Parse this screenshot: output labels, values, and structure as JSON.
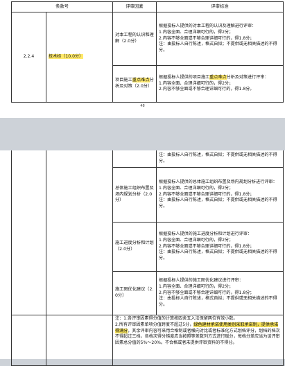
{
  "page1": {
    "headers": [
      "条款号",
      "评审因素",
      "评审标准"
    ],
    "clause_no": "2.2.4",
    "tech_label": "技术标（10.0分）",
    "rows": [
      {
        "factor": "对本工程的认识和理解（2.0分）",
        "lines": [
          "根据投标人提供的对本工程的认识及理解进行评审：",
          "1.内容全面、合理详细可行的，得2分；",
          "2.内容不够全面或不够合理详细可行的，得1.8分；",
          "注：由投标人自行陈述，格式自拟；不提供或无相关描述的不得分。"
        ]
      },
      {
        "factor_pre": "项目施工",
        "factor_hl": "重点难点",
        "factor_post": "分析及对策（2.0分）",
        "std_pre": "根据投标人提供的项目施工",
        "std_hl": "重点难点",
        "std_post": "分析及对策进行评审：",
        "lines": [
          "1.内容全面、合理详细可行的，得2分；",
          "2.内容不够全面或不够合理详细可行的，得1.8分。"
        ]
      }
    ],
    "page_number": "48"
  },
  "page2": {
    "top_note": "注：由投标人自行陈述，格式自拟；不提供或无相关描述的不得分。",
    "rows": [
      {
        "factor": "总体施工组织布置及场内规划分析（2.0分）",
        "lines": [
          "根据投标人提供的总体施工组织布置及场内规划分析进行评审：",
          "1.内容全面、合理详细可行的，得2分；",
          "2.内容不够全面或不够合理详细可行的，得1.8分；",
          "注：由投标人自行陈述，格式自拟；不提供或无相关描述的不得分。"
        ]
      },
      {
        "factor": "施工进度分析和计划（2.0分）",
        "lines": [
          "根据投标人提供的施工进度分析和计划进行评审：",
          "1.内容全面、合理详细可行的，得2分；",
          "2.内容不够全面或不够合理详细可行的，得1.8分；",
          "注：由投标人自行陈述，格式自拟；不提供或无相关描述的不得分。"
        ]
      },
      {
        "factor": "施工图优化建议（2.0分）",
        "lines": [
          "根据投标人提供的施工图优化建议进行评审：",
          "1.内容全面、合理详细可行的，得2分；",
          "2.内容不够全面或不够合理详细可行的，得1.8分；",
          "注：由投标人自行陈述，格式自拟；不提供或无相关描述的不得分。"
        ]
      }
    ],
    "note": {
      "line1": "注：1.各评审因素得分值的计算按四舍五入法保留两位有效小数。",
      "line2_pre": "2.所有评审因素单项分值跨度不超过5分，",
      "line2_hl": "绿色建材承诺使用类别采取承诺制，提供承诺得满分",
      "line2_post": "，其余评审内容可采用合格制或者横向对比或者标准化方式划档评分，划档的档次不得超过三档，各档次得分梯度应当按照等差数列方式进行赋分，每档分差应当为该评审因素总分值的5%～20%。不合格或者未提供评审资料的不得分。"
    }
  }
}
